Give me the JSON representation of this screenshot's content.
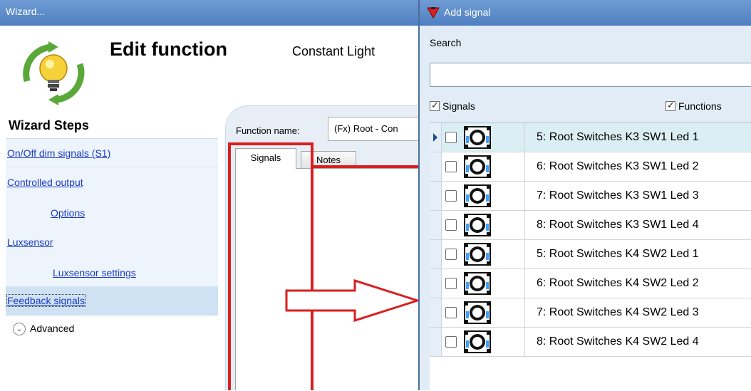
{
  "wizard": {
    "title": "Wizard...",
    "page_title": "Edit function",
    "function_type": "Constant Light",
    "steps_heading": "Wizard Steps",
    "steps": [
      {
        "label": "On/Off dim signals (S1)"
      },
      {
        "label": "Controlled output"
      },
      {
        "label": "Options"
      },
      {
        "label": "Luxsensor"
      },
      {
        "label": "Luxsensor settings"
      },
      {
        "label": "Feedback signals",
        "selected": true
      }
    ],
    "advanced_label": "Advanced",
    "function_name_label": "Function name:",
    "function_name_value": "(Fx) Root - Con",
    "tabs": [
      {
        "label": "Signals",
        "active": true
      },
      {
        "label": "Notes",
        "active": false
      }
    ]
  },
  "dialog": {
    "title": "Add signal",
    "search_label": "Search",
    "search_value": "",
    "filters": [
      {
        "label": "Signals",
        "checked": true
      },
      {
        "label": "Functions",
        "checked": true
      }
    ],
    "rows": [
      {
        "label": "5: Root Switches K3 SW1 Led 1",
        "checked": false,
        "current": true
      },
      {
        "label": "6: Root Switches K3 SW1 Led 2",
        "checked": false
      },
      {
        "label": "7: Root Switches K3 SW1 Led 3",
        "checked": false
      },
      {
        "label": "8: Root Switches K3 SW1 Led 4",
        "checked": false
      },
      {
        "label": "5: Root Switches K4 SW2 Led 1",
        "checked": false
      },
      {
        "label": "6: Root Switches K4 SW2 Led 2",
        "checked": false
      },
      {
        "label": "7: Root Switches K4 SW2 Led 3",
        "checked": false
      },
      {
        "label": "8: Root Switches K4 SW2 Led 4",
        "checked": false
      }
    ]
  },
  "colors": {
    "titlebar": "#5b8ac9",
    "link": "#1a3cc4",
    "highlight_red": "#d81f1f",
    "selected_row": "#dbeef3"
  }
}
